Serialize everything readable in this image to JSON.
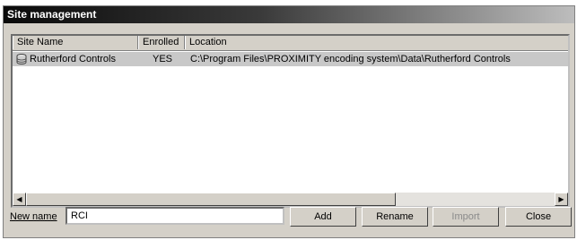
{
  "window": {
    "title": "Site management"
  },
  "list": {
    "columns": [
      "Site Name",
      "Enrolled",
      "Location"
    ],
    "rows": [
      {
        "site_name": "Rutherford Controls",
        "enrolled": "YES",
        "location": "C:\\Program Files\\PROXIMITY encoding system\\Data\\Rutherford Controls",
        "icon": "database-icon"
      }
    ],
    "scroll_left_glyph": "◀",
    "scroll_right_glyph": "▶"
  },
  "form": {
    "new_name_label": "New name",
    "new_name_value": "RCI"
  },
  "buttons": {
    "add": "Add",
    "rename": "Rename",
    "import": "Import",
    "close": "Close"
  }
}
